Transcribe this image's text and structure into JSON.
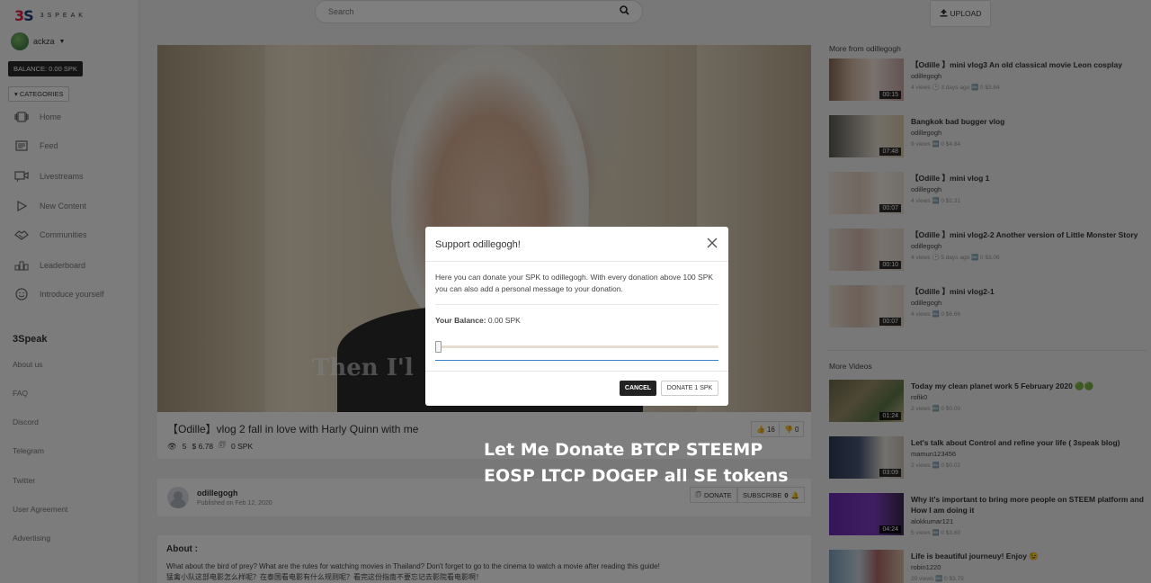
{
  "sidebar": {
    "logo_mark": "3S",
    "logo_text": "3SPEAK",
    "username": "ackza",
    "balance": "BALANCE: 0.00 SPK",
    "categories_label": "CATEGORIES",
    "nav": [
      {
        "label": "Home",
        "icon": "home-icon"
      },
      {
        "label": "Feed",
        "icon": "feed-icon"
      },
      {
        "label": "Livestreams",
        "icon": "livestream-icon"
      },
      {
        "label": "New Content",
        "icon": "play-icon"
      },
      {
        "label": "Communities",
        "icon": "communities-icon"
      },
      {
        "label": "Leaderboard",
        "icon": "leaderboard-icon"
      },
      {
        "label": "Introduce yourself",
        "icon": "smile-icon"
      }
    ],
    "section_title": "3Speak",
    "links": [
      "About us",
      "FAQ",
      "Discord",
      "Telegram",
      "Twitter",
      "User Agreement",
      "Advertising"
    ]
  },
  "header": {
    "search_placeholder": "Search",
    "upload_label": "UPLOAD"
  },
  "video": {
    "subtitle_overlay": "Then I'l",
    "title": "【Odille】vlog 2 fall in love with Harly Quinn with me",
    "views": "5",
    "earnings": "$ 6.78",
    "spk": "0 SPK",
    "upvotes": "16",
    "downvotes": "0"
  },
  "channel": {
    "name": "odillegogh",
    "published": "Published on Feb 12, 2020",
    "donate_label": "DONATE",
    "subscribe_label": "SUBSCRIBE",
    "subscribe_count": "0"
  },
  "about": {
    "title": "About :",
    "line1": "What about the bird of prey? What are the rules for watching movies in Thailand? Don't forget to go to the cinema to watch a movie after reading this guide!",
    "line2": "猛禽小队这部电影怎么样呢？在泰国看电影有什么规则呢？看完这份指南不要忘记去影院看电影啊！"
  },
  "right": {
    "more_from_heading": "More from odillegogh",
    "more_from": [
      {
        "title": "【Odille 】mini vlog3 An old classical movie Leon cosplay",
        "author": "odillegogh",
        "meta": "4 views 🕑 3 days ago 🔤 0  $3.84",
        "duration": "00:15"
      },
      {
        "title": "Bangkok bad bugger vlog",
        "author": "odillegogh",
        "meta": "9 views 🔤 0  $4.84",
        "duration": "07:48"
      },
      {
        "title": "【Odille 】mini vlog 1",
        "author": "odillegogh",
        "meta": "4 views 🔤 0  $2.31",
        "duration": "00:07"
      },
      {
        "title": "【Odille 】mini vlog2-2 Another version of Little Monster Story",
        "author": "odillegogh",
        "meta": "4 views 🕑 5 days ago 🔤 0  $3.06",
        "duration": "00:10"
      },
      {
        "title": "【Odille 】mini vlog2-1",
        "author": "odillegogh",
        "meta": "4 views 🔤 0  $6.66",
        "duration": "00:07"
      }
    ],
    "more_videos_heading": "More Videos",
    "more_videos": [
      {
        "title": "Today my clean planet work 5 February 2020 🟢🟢",
        "author": "rofik0",
        "meta": "2 views 🔤 0  $0.00",
        "duration": "01:24"
      },
      {
        "title": "Let's talk about Control and refine your life ( 3speak blog)",
        "author": "mamun123456",
        "meta": "2 views 🔤 0  $0.02",
        "duration": "03:09"
      },
      {
        "title": "Why it's important to bring more people on STEEM platform and How I am doing it",
        "author": "alokkumar121",
        "meta": "5 views 🔤 0  $3.60",
        "duration": "04:24"
      },
      {
        "title": "Life is beautiful journeuy! Enjoy 😉",
        "author": "robin1220",
        "meta": "20 views 🔤 0  $3.79",
        "duration": ""
      }
    ]
  },
  "modal": {
    "title": "Support odillegogh!",
    "description": "Here you can donate your SPK to odillegogh. With every donation above 100 SPK you can also add a personal message to your donation.",
    "balance_label": "Your Balance:",
    "balance_value": "0.00 SPK",
    "slider_value": 0,
    "cancel_label": "CANCEL",
    "donate_label": "DONATE 1 SPK"
  },
  "banner": {
    "line1": "Let Me Donate BTCP STEEMP",
    "line2": "EOSP LTCP DOGEP all SE tokens"
  },
  "colors": {
    "balance_bg": "#2b2b2b",
    "cancel_bg": "#222222",
    "slider_underline": "#3b82c4"
  }
}
